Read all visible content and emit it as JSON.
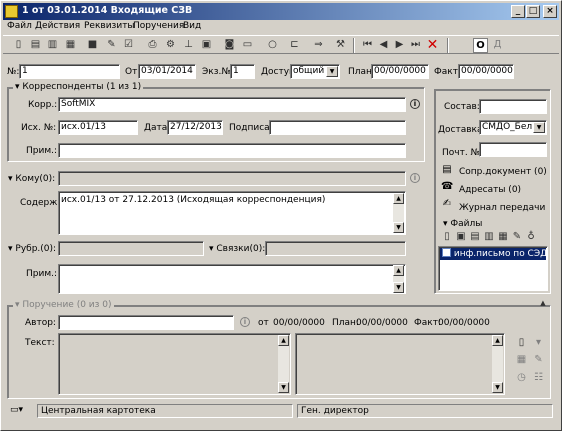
{
  "window": {
    "title": "1 от 03.01.2014 Входящие СЗВ",
    "min": "_",
    "max": "□",
    "close": "×"
  },
  "menu": [
    "Файл",
    "Действия",
    "Реквизиты",
    "Поручения",
    "Вид"
  ],
  "toolbar": {
    "o_label": "О",
    "d_label": "Д"
  },
  "header": {
    "num_label": "№:",
    "num_value": "1",
    "from_label": "От:",
    "from_value": "03/01/2014",
    "copy_label": "Экз.№:",
    "copy_value": "1",
    "access_label": "Доступ:",
    "access_value": "общий",
    "plan_label": "План:",
    "plan_value": "00/00/0000",
    "fact_label": "Факт:",
    "fact_value": "00/00/0000"
  },
  "correspondents": {
    "title": "Корреспонденты (1 из 1)",
    "korr_label": "Корр.:",
    "korr_value": "SoftMIX",
    "ish_label": "Исх. №:",
    "ish_value": "исх.01/13",
    "date_label": "Дата:",
    "date_value": "27/12/2013",
    "signed_label": "Подписал:",
    "signed_value": "",
    "prim_label": "Прим.:",
    "prim_value": ""
  },
  "right_panel": {
    "sostav_label": "Состав:",
    "sostav_value": "",
    "dostavka_label": "Доставка:",
    "dostavka_value": "СМДО_Бел",
    "poch_label": "Почт. №:",
    "poch_value": "",
    "links": [
      "Сопр.документ (0)",
      "Адресаты (0)",
      "Журнал передачи"
    ],
    "files_title": "Файлы",
    "files": [
      "инф.письмо по СЭД"
    ]
  },
  "body": {
    "komu_label": "Кому(0):",
    "komu_value": "",
    "soderzh_label": "Содерж.:",
    "soderzh_value": "исх.01/13 от 27.12.2013 (Исходящая корреспонденция)",
    "rubr_label": "Рубр.(0):",
    "rubr_value": "",
    "svyazi_label": "Связки(0):",
    "svyazi_value": "",
    "prim_label": "Прим.:",
    "prim_value": ""
  },
  "poruchenie": {
    "title": "Поручение (0 из 0)",
    "author_label": "Автор:",
    "author_value": "",
    "ot_label": "от",
    "ot_value": "00/00/0000",
    "plan_label": "План:",
    "plan_value": "00/00/0000",
    "fact_label": "Факт:",
    "fact_value": "00/00/0000",
    "text_label": "Текст:"
  },
  "status": {
    "left": "Центральная картотека",
    "right": "Ген. директор"
  }
}
